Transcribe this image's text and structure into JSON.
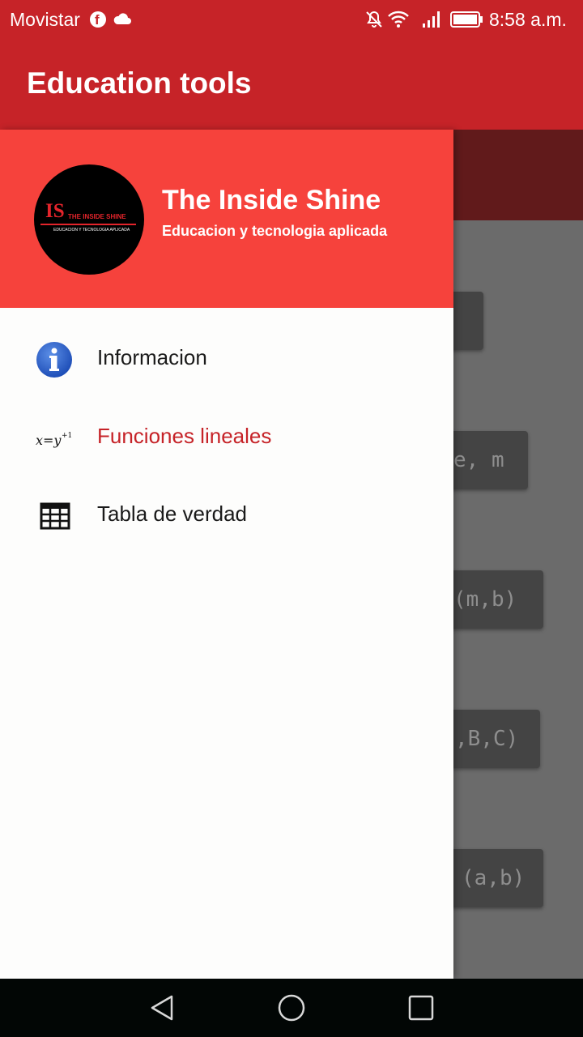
{
  "status_bar": {
    "carrier": "Movistar",
    "time": "8:58 a.m.",
    "icons": [
      "facebook-icon",
      "cloud-icon",
      "mute-icon",
      "wifi-icon",
      "signal-icon",
      "battery-icon"
    ]
  },
  "app_bar": {
    "title": "Education tools"
  },
  "drawer": {
    "header": {
      "logo_text": "IS",
      "logo_name": "THE INSIDE SHINE",
      "logo_tagline": "EDUCACION Y TECNOLOGIA APLICADA",
      "title": "The Inside Shine",
      "subtitle": "Educacion y tecnologia aplicada"
    },
    "items": [
      {
        "label": "Informacion",
        "icon": "info-icon",
        "active": false
      },
      {
        "label": "Funciones lineales",
        "icon": "linear-function-icon",
        "active": true
      },
      {
        "label": "Tabla de verdad",
        "icon": "table-icon",
        "active": false
      }
    ]
  },
  "background": {
    "buttons": [
      "",
      "e, m",
      "(m,b)",
      ",B,C)",
      "(a,b)"
    ]
  },
  "colors": {
    "primary": "#c62328",
    "header": "#f6423c",
    "active_text": "#c62328"
  },
  "nav_bar": {
    "icons": [
      "back-icon",
      "home-icon",
      "recents-icon"
    ]
  }
}
